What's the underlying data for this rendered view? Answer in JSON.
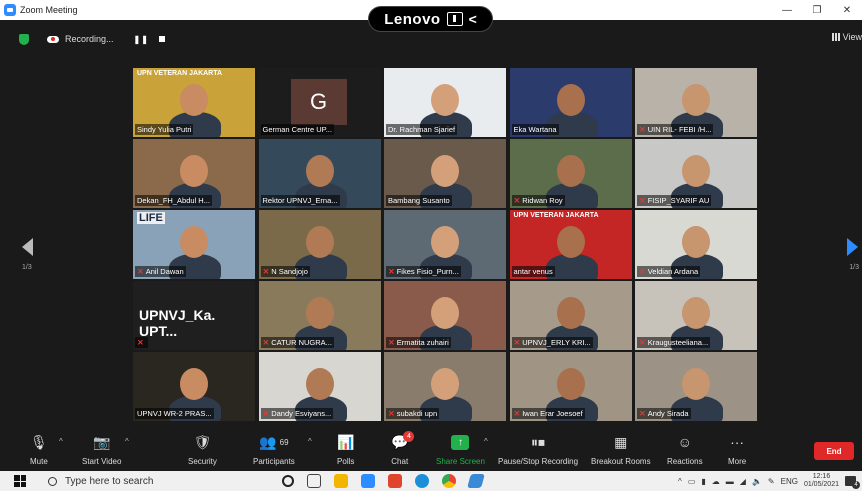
{
  "window": {
    "title": "Zoom Meeting",
    "controls": [
      "—",
      "❐",
      "✕"
    ]
  },
  "overlay": {
    "brand": "Lenovo",
    "back": "<"
  },
  "recording": {
    "label": "Recording...",
    "pause": "❚❚",
    "view": "View"
  },
  "gallery": {
    "page_current": "1/3",
    "page_right": "1/3",
    "participants": [
      {
        "name": "Sindy Yulia Putri",
        "muted": false,
        "speaking": true,
        "bg": "#c9a23a",
        "banner": "UPN VETERAN JAKARTA"
      },
      {
        "name": "German Centre UP...",
        "muted": false,
        "bg": "#1c1c1c",
        "letter": "G"
      },
      {
        "name": "Dr. Rachman Sjarief",
        "muted": false,
        "bg": "#e8ecef"
      },
      {
        "name": "Eka Wartana",
        "muted": false,
        "bg": "#2b3b6c"
      },
      {
        "name": "UIN RIL- FEBI /H...",
        "muted": true,
        "bg": "#b8b2a8"
      },
      {
        "name": "Dekan_FH_Abdul H...",
        "muted": false,
        "bg": "#8a6a4a"
      },
      {
        "name": "Rektor UPNVJ_Erna...",
        "muted": false,
        "bg": "#344a5a"
      },
      {
        "name": "Bambang Susanto",
        "muted": false,
        "bg": "#6a5a4c"
      },
      {
        "name": "Ridwan Roy",
        "muted": true,
        "bg": "#5c6d4c"
      },
      {
        "name": "FISIP_SYARIF AU",
        "muted": true,
        "bg": "#c8c8c6"
      },
      {
        "name": "Anil Dawan",
        "muted": true,
        "bg": "#8aa2b8",
        "banner": "LIFE"
      },
      {
        "name": "N Sandjojo",
        "muted": true,
        "bg": "#7a6a4a"
      },
      {
        "name": "Fikes Fisio_Purn...",
        "muted": true,
        "bg": "#5d6a74"
      },
      {
        "name": "antar venus",
        "muted": false,
        "bg": "#c42525",
        "banner": "UPN VETERAN JAKARTA"
      },
      {
        "name": "Veldian Ardana",
        "muted": true,
        "bg": "#d9d9d4"
      },
      {
        "name": "",
        "muted": true,
        "bg": "#1f1f1f",
        "bigname": "UPNVJ_Ka. UPT..."
      },
      {
        "name": "CATUR NUGRA...",
        "muted": true,
        "bg": "#8a7a5c"
      },
      {
        "name": "Ermatita zuhairi",
        "muted": true,
        "bg": "#8a5a4a"
      },
      {
        "name": "UPNVJ_ERLY KRI...",
        "muted": true,
        "bg": "#a69a8a"
      },
      {
        "name": "Kraugusteeliana...",
        "muted": true,
        "bg": "#c7c2ba"
      },
      {
        "name": "UPNVJ WR-2 PRAS...",
        "muted": false,
        "bg": "#2a2620"
      },
      {
        "name": "Dandy Esviyans...",
        "muted": true,
        "bg": "#d8d6d0"
      },
      {
        "name": "subakdi upn",
        "muted": true,
        "bg": "#8a7c6c"
      },
      {
        "name": "Iwan Erar Joesoef",
        "muted": true,
        "bg": "#a09484"
      },
      {
        "name": "Andy Sirada",
        "muted": true,
        "bg": "#9c9286"
      }
    ]
  },
  "toolbar": {
    "mute": "Mute",
    "start_video": "Start Video",
    "security": "Security",
    "participants": "Participants",
    "participants_count": "69",
    "polls": "Polls",
    "chat": "Chat",
    "chat_badge": "4",
    "share_screen": "Share Screen",
    "pause_recording": "Pause/Stop Recording",
    "breakout": "Breakout Rooms",
    "reactions": "Reactions",
    "more": "More",
    "end": "End"
  },
  "taskbar": {
    "search_placeholder": "Type here to search",
    "lang": "ENG",
    "time": "12:16",
    "date": "01/05/2021",
    "notifications": "4"
  }
}
